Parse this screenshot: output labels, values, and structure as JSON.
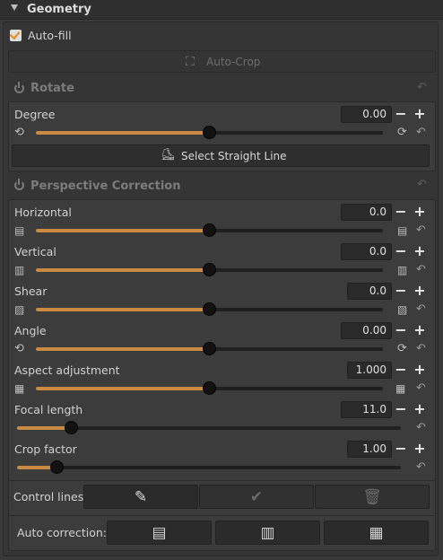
{
  "header": {
    "title": "Geometry",
    "collapse_icon": "triangle-down-icon"
  },
  "autofill": {
    "label": "Auto-fill",
    "checked": true
  },
  "autocrop": {
    "label": "Auto-Crop",
    "icon": "crop-icon",
    "enabled": false
  },
  "rotate": {
    "title": "Rotate",
    "degree": {
      "label": "Degree",
      "value": "0.00",
      "level": 0.5
    },
    "straight_line_label": "Select Straight Line"
  },
  "perspective": {
    "title": "Perspective Correction",
    "sliders": [
      {
        "label": "Horizontal",
        "value": "0.0",
        "level": 0.5,
        "left_icon": "horizontal-perspective-left-icon",
        "right_icon": "horizontal-perspective-right-icon"
      },
      {
        "label": "Vertical",
        "value": "0.0",
        "level": 0.5,
        "left_icon": "vertical-perspective-left-icon",
        "right_icon": "vertical-perspective-right-icon"
      },
      {
        "label": "Shear",
        "value": "0.0",
        "level": 0.5,
        "left_icon": "shear-left-icon",
        "right_icon": "shear-right-icon"
      },
      {
        "label": "Angle",
        "value": "0.00",
        "level": 0.5,
        "left_icon": "rotate-left-icon",
        "right_icon": "rotate-right-icon"
      },
      {
        "label": "Aspect adjustment",
        "value": "1.000",
        "level": 0.5,
        "left_icon": "aspect-narrow-icon",
        "right_icon": "aspect-wide-icon"
      },
      {
        "label": "Focal length",
        "value": "11.0",
        "level": 0.14
      },
      {
        "label": "Crop factor",
        "value": "1.00",
        "level": 0.1
      }
    ],
    "control_lines_label": "Control lines:",
    "auto_correction_label": "Auto correction:"
  },
  "glyphs": {
    "minus": "−",
    "plus": "+",
    "reset": "↶",
    "rot_l": "⟲",
    "rot_r": "⟳"
  },
  "colors": {
    "accent": "#c98a42",
    "checkbox_tick": "#e08a1e"
  }
}
